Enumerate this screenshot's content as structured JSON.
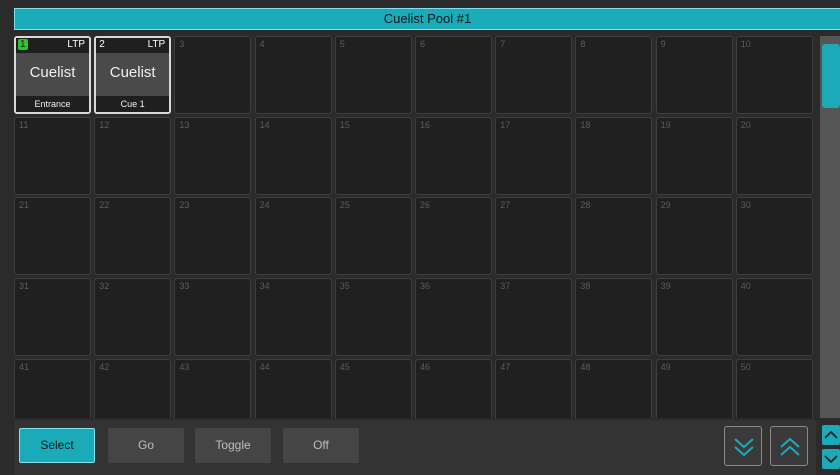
{
  "title": "Cuelist Pool #1",
  "pool": {
    "cells": [
      {
        "num": "1",
        "active": true,
        "mode": "LTP",
        "name": "Cuelist",
        "label": "Entrance"
      },
      {
        "num": "2",
        "active": false,
        "mode": "LTP",
        "name": "Cuelist",
        "label": "Cue 1"
      },
      {
        "num": "3"
      },
      {
        "num": "4"
      },
      {
        "num": "5"
      },
      {
        "num": "6"
      },
      {
        "num": "7"
      },
      {
        "num": "8"
      },
      {
        "num": "9"
      },
      {
        "num": "10"
      },
      {
        "num": "11"
      },
      {
        "num": "12"
      },
      {
        "num": "13"
      },
      {
        "num": "14"
      },
      {
        "num": "15"
      },
      {
        "num": "16"
      },
      {
        "num": "17"
      },
      {
        "num": "18"
      },
      {
        "num": "19"
      },
      {
        "num": "20"
      },
      {
        "num": "21"
      },
      {
        "num": "22"
      },
      {
        "num": "23"
      },
      {
        "num": "24"
      },
      {
        "num": "25"
      },
      {
        "num": "26"
      },
      {
        "num": "27"
      },
      {
        "num": "28"
      },
      {
        "num": "29"
      },
      {
        "num": "30"
      },
      {
        "num": "31"
      },
      {
        "num": "32"
      },
      {
        "num": "33"
      },
      {
        "num": "34"
      },
      {
        "num": "35"
      },
      {
        "num": "36"
      },
      {
        "num": "37"
      },
      {
        "num": "38"
      },
      {
        "num": "39"
      },
      {
        "num": "40"
      },
      {
        "num": "41"
      },
      {
        "num": "42"
      },
      {
        "num": "43"
      },
      {
        "num": "44"
      },
      {
        "num": "45"
      },
      {
        "num": "46"
      },
      {
        "num": "47"
      },
      {
        "num": "48"
      },
      {
        "num": "49"
      },
      {
        "num": "50"
      }
    ]
  },
  "toolbar": {
    "select_label": "Select",
    "go_label": "Go",
    "toggle_label": "Toggle",
    "off_label": "Off",
    "active_button": "Select"
  },
  "icons": {
    "page_down": "double-chevron-down-icon",
    "page_up": "double-chevron-up-icon",
    "scroll_up": "chevron-up-icon",
    "scroll_down": "chevron-down-icon"
  },
  "colors": {
    "accent": "#1aaab8",
    "active_cue": "#2fc42f",
    "background": "#2b2b2b",
    "cell_empty": "#202020"
  }
}
